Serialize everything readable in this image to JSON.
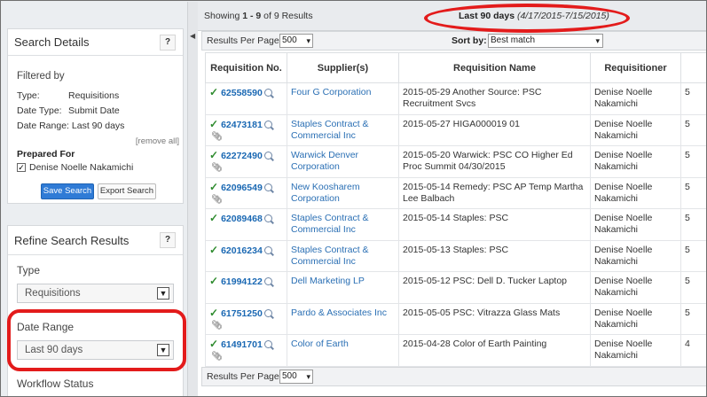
{
  "results_summary": {
    "prefix": "Showing",
    "range": "1 - 9",
    "suffix": "of 9 Results"
  },
  "date_range": {
    "label": "Last 90 days",
    "dates": "(4/17/2015-7/15/2015)"
  },
  "search_details": {
    "title": "Search Details",
    "help": "?",
    "filtered_by": "Filtered by",
    "filters": [
      {
        "key": "Type:",
        "value": "Requisitions"
      },
      {
        "key": "Date Type:",
        "value": "Submit Date"
      },
      {
        "key": "Date Range:",
        "value": "Last 90 days"
      }
    ],
    "remove_all": "[remove all]",
    "prepared_for_label": "Prepared For",
    "prepared_for_name": "Denise Noelle Nakamichi",
    "save_button": "Save Search",
    "export_button": "Export Search"
  },
  "refine": {
    "title": "Refine Search Results",
    "help": "?",
    "type_label": "Type",
    "type_value": "Requisitions",
    "date_range_label": "Date Range",
    "date_range_value": "Last 90 days",
    "workflow_label": "Workflow Status"
  },
  "toolbar": {
    "per_page_label": "Results Per Page",
    "per_page_value": "500",
    "sort_label": "Sort by:",
    "sort_value": "Best match"
  },
  "table": {
    "headers": [
      "Requisition No.",
      "Supplier(s)",
      "Requisition Name",
      "Requisitioner",
      ""
    ],
    "rows": [
      {
        "id": "62558590",
        "attach": false,
        "supplier": "Four G Corporation",
        "name": "2015-05-29 Another Source: PSC Recruitment Svcs",
        "requisitioner": "Denise Noelle Nakamichi",
        "extra": "5"
      },
      {
        "id": "62473181",
        "attach": true,
        "supplier": "Staples Contract & Commercial Inc",
        "name": "2015-05-27 HIGA000019 01",
        "requisitioner": "Denise Noelle Nakamichi",
        "extra": "5"
      },
      {
        "id": "62272490",
        "attach": true,
        "supplier": "Warwick Denver Corporation",
        "name": "2015-05-20 Warwick: PSC CO Higher Ed Proc Summit 04/30/2015",
        "requisitioner": "Denise Noelle Nakamichi",
        "extra": "5"
      },
      {
        "id": "62096549",
        "attach": true,
        "supplier": "New Koosharem Corporation",
        "name": "2015-05-14 Remedy: PSC AP Temp Martha Lee Balbach",
        "requisitioner": "Denise Noelle Nakamichi",
        "extra": "5"
      },
      {
        "id": "62089468",
        "attach": false,
        "supplier": "Staples Contract & Commercial Inc",
        "name": "2015-05-14 Staples: PSC",
        "requisitioner": "Denise Noelle Nakamichi",
        "extra": "5"
      },
      {
        "id": "62016234",
        "attach": false,
        "supplier": "Staples Contract & Commercial Inc",
        "name": "2015-05-13 Staples: PSC",
        "requisitioner": "Denise Noelle Nakamichi",
        "extra": "5"
      },
      {
        "id": "61994122",
        "attach": false,
        "supplier": "Dell Marketing LP",
        "name": "2015-05-12 PSC: Dell D. Tucker Laptop",
        "requisitioner": "Denise Noelle Nakamichi",
        "extra": "5"
      },
      {
        "id": "61751250",
        "attach": true,
        "supplier": "Pardo & Associates Inc",
        "name": "2015-05-05 PSC: Vitrazza Glass Mats",
        "requisitioner": "Denise Noelle Nakamichi",
        "extra": "5"
      },
      {
        "id": "61491701",
        "attach": true,
        "supplier": "Color of Earth",
        "name": "2015-04-28 Color of Earth Painting",
        "requisitioner": "Denise Noelle Nakamichi",
        "extra": "4"
      }
    ]
  },
  "highlight_color": "#e31b1b"
}
